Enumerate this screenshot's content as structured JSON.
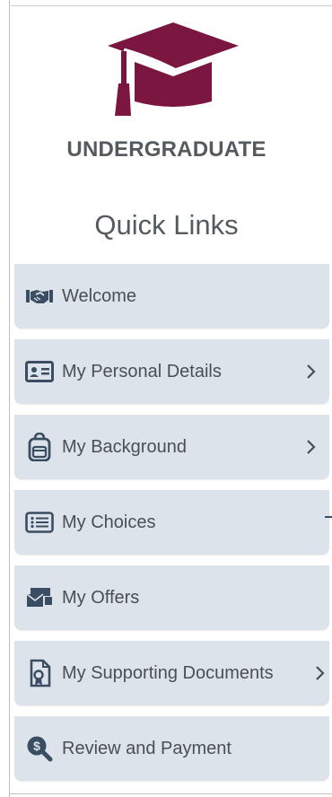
{
  "brand": {
    "title": "UNDERGRADUATE",
    "logo_icon": "graduation-cap-icon",
    "logo_color": "#7a1640"
  },
  "quick_links": {
    "heading": "Quick Links"
  },
  "nav": {
    "items": [
      {
        "label": "Welcome",
        "icon": "handshake-icon",
        "has_chevron": false
      },
      {
        "label": "My Personal Details",
        "icon": "id-card-icon",
        "has_chevron": true
      },
      {
        "label": "My Background",
        "icon": "backpack-icon",
        "has_chevron": true
      },
      {
        "label": "My Choices",
        "icon": "list-icon",
        "has_chevron": false
      },
      {
        "label": "My Offers",
        "icon": "envelope-icon",
        "has_chevron": false
      },
      {
        "label": "My Supporting Documents",
        "icon": "document-badge-icon",
        "has_chevron": true
      },
      {
        "label": "Review and Payment",
        "icon": "payment-search-icon",
        "has_chevron": false
      }
    ]
  },
  "colors": {
    "item_bg": "#dde3ea",
    "icon": "#3a4d63",
    "text": "#4a4f55"
  }
}
